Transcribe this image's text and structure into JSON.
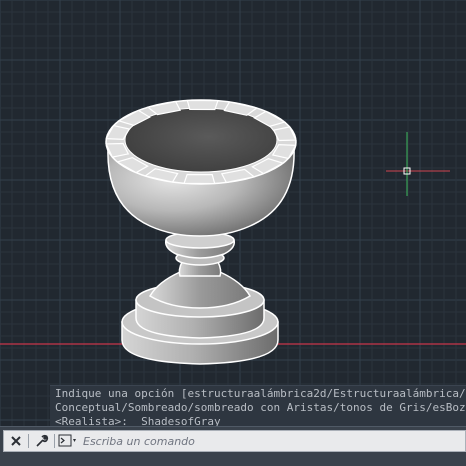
{
  "history": {
    "lines": [
      "Indique una opción [estructuraalámbrica2d/Estructuraalámbrica/ocUlto/",
      "Conceptual/Sombreado/sombreado con Aristas/tonos de Gris/esBozo/rayos",
      "<Realista>:  _ShadesofGray"
    ]
  },
  "commandline": {
    "placeholder": "Escriba un comando",
    "close_icon": "close-icon",
    "settings_icon": "wrench-icon",
    "prompt_icon": "command-prompt-icon"
  },
  "viewport": {
    "background": "#212830",
    "grid_minor": "#2a333d",
    "grid_major": "#34404c",
    "x_axis_color": "#c8344a",
    "y_axis_color": "#2e9e4e",
    "crosshair_x_color": "#d0454f",
    "crosshair_y_color": "#3cb85c",
    "visual_style": "ShadesofGray"
  }
}
